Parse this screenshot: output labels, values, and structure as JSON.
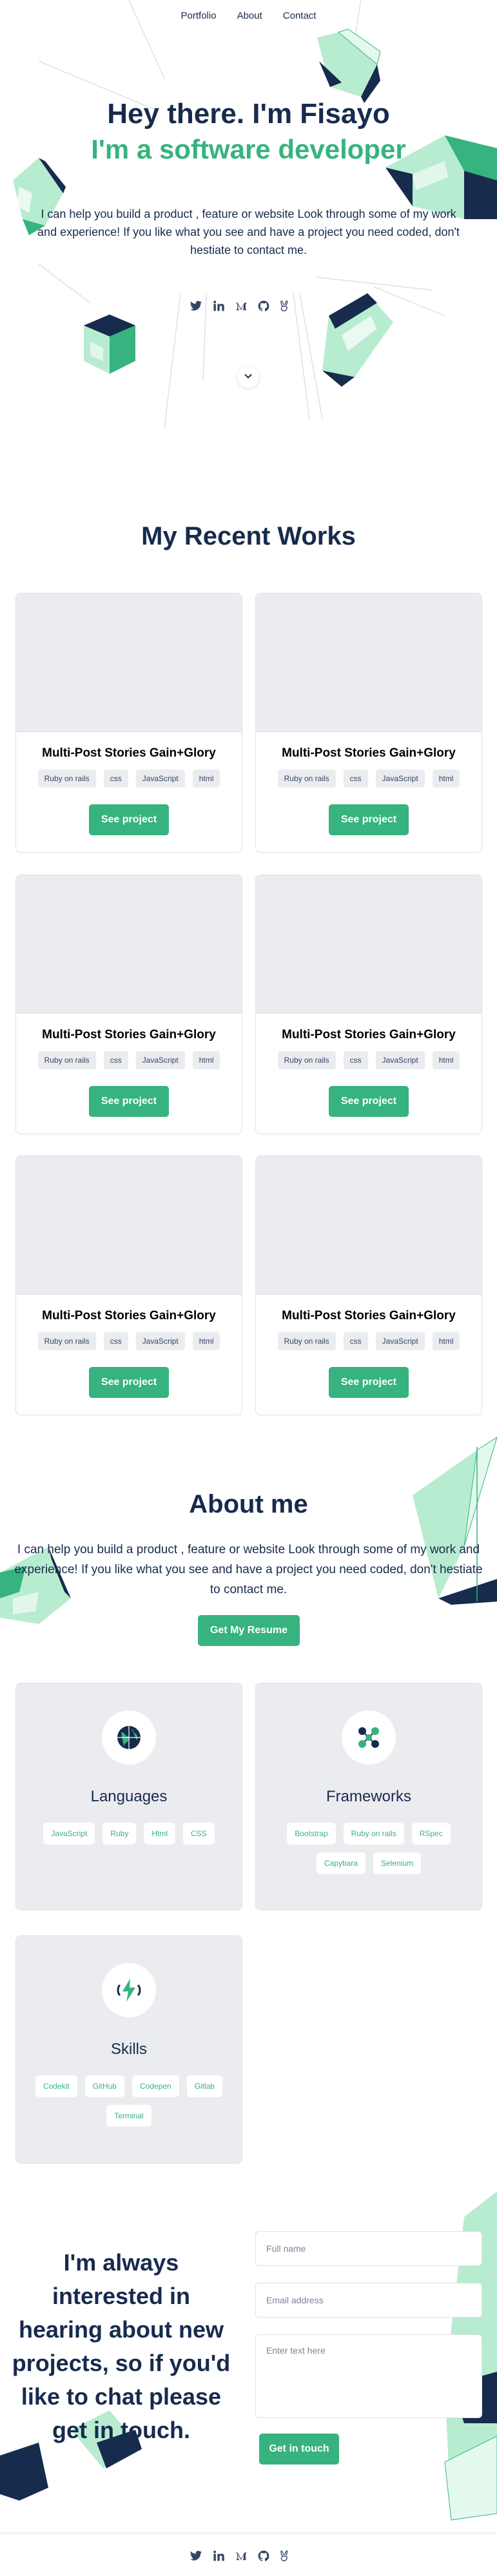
{
  "nav": {
    "items": [
      "Portfolio",
      "About",
      "Contact"
    ]
  },
  "hero": {
    "title": "Hey there. I'm Fisayo",
    "subtitle": "I'm a software developer",
    "description": "I can help you build a product , feature or website Look through some of my work and experience! If you like what you see and have a project you need coded, don't hestiate to contact me."
  },
  "social_icons": [
    "twitter-icon",
    "linkedin-icon",
    "medium-icon",
    "github-icon",
    "angellist-icon"
  ],
  "works": {
    "title": "My Recent Works",
    "projects": [
      {
        "title": "Multi-Post Stories Gain+Glory",
        "tags": [
          "Ruby on rails",
          "css",
          "JavaScript",
          "html"
        ],
        "button": "See project"
      },
      {
        "title": "Multi-Post Stories Gain+Glory",
        "tags": [
          "Ruby on rails",
          "css",
          "JavaScript",
          "html"
        ],
        "button": "See project"
      },
      {
        "title": "Multi-Post Stories Gain+Glory",
        "tags": [
          "Ruby on rails",
          "css",
          "JavaScript",
          "html"
        ],
        "button": "See project"
      },
      {
        "title": "Multi-Post Stories Gain+Glory",
        "tags": [
          "Ruby on rails",
          "css",
          "JavaScript",
          "html"
        ],
        "button": "See project"
      },
      {
        "title": "Multi-Post Stories Gain+Glory",
        "tags": [
          "Ruby on rails",
          "css",
          "JavaScript",
          "html"
        ],
        "button": "See project"
      },
      {
        "title": "Multi-Post Stories Gain+Glory",
        "tags": [
          "Ruby on rails",
          "css",
          "JavaScript",
          "html"
        ],
        "button": "See project"
      }
    ]
  },
  "about": {
    "title": "About me",
    "description": "I can help you build a product , feature or website Look through some of my work and experience! If you like what you see and have a project you need coded, don't hestiate to contact me.",
    "resume_button": "Get My Resume"
  },
  "skills": [
    {
      "title": "Languages",
      "icon": "globe-icon",
      "items": [
        "JavaScript",
        "Ruby",
        "Html",
        "CSS"
      ]
    },
    {
      "title": "Frameworks",
      "icon": "molecule-icon",
      "items": [
        "Bootstrap",
        "Ruby on rails",
        "RSpec",
        "Capybara",
        "Selenium"
      ]
    },
    {
      "title": "Skills",
      "icon": "lightning-icon",
      "items": [
        "Codekit",
        "GitHub",
        "Codepen",
        "Gitlab",
        "Terminal"
      ]
    }
  ],
  "contact": {
    "text": "I'm always interested in hearing about new projects, so if you'd like to chat please get in touch.",
    "name_placeholder": "Full name",
    "email_placeholder": "Email address",
    "message_placeholder": "Enter text here",
    "button": "Get in touch"
  },
  "colors": {
    "accent": "#36b37e",
    "navy": "#172b4d",
    "light_green": "#b7ecd0",
    "gray": "#ebecf0"
  }
}
